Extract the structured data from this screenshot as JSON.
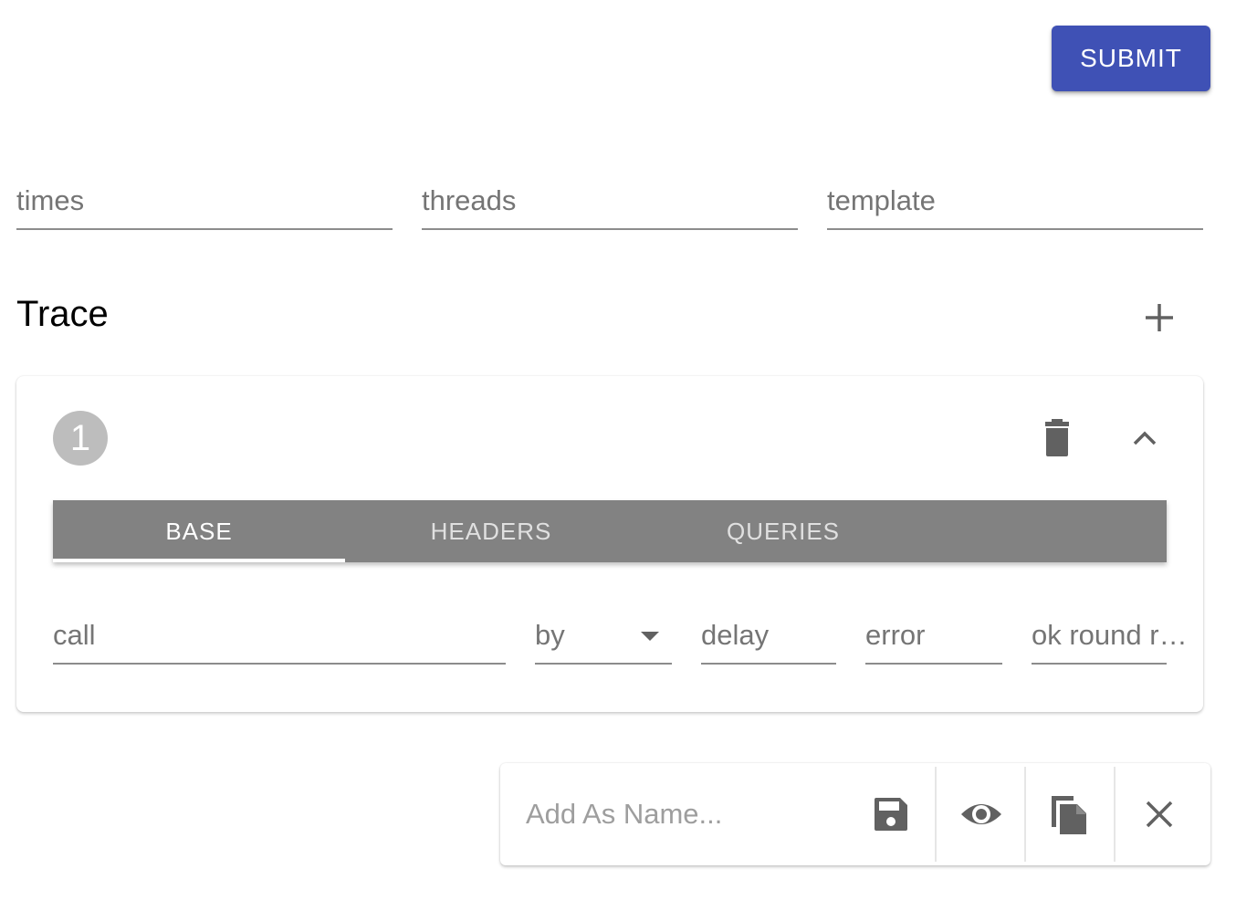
{
  "header": {
    "submit_label": "SUBMIT"
  },
  "top_fields": [
    {
      "label": "times"
    },
    {
      "label": "threads"
    },
    {
      "label": "template"
    }
  ],
  "trace": {
    "title": "Trace",
    "add_icon": "plus-icon",
    "step": {
      "number": "1",
      "delete_icon": "trash-icon",
      "collapse_icon": "chevron-up-icon",
      "tabs": [
        {
          "label": "BASE",
          "active": true
        },
        {
          "label": "HEADERS",
          "active": false
        },
        {
          "label": "QUERIES",
          "active": false
        }
      ],
      "fields": {
        "call": "call",
        "by": "by",
        "delay": "delay",
        "error": "error",
        "ok_round": "ok round r…"
      }
    }
  },
  "toolbar": {
    "name_placeholder": "Add As Name...",
    "icons": [
      "save-icon",
      "eye-icon",
      "copy-icon",
      "close-icon"
    ]
  },
  "colors": {
    "primary": "#3f51b5",
    "tab_bar": "#828282",
    "badge": "#bdbdbd",
    "icon": "#616161"
  }
}
